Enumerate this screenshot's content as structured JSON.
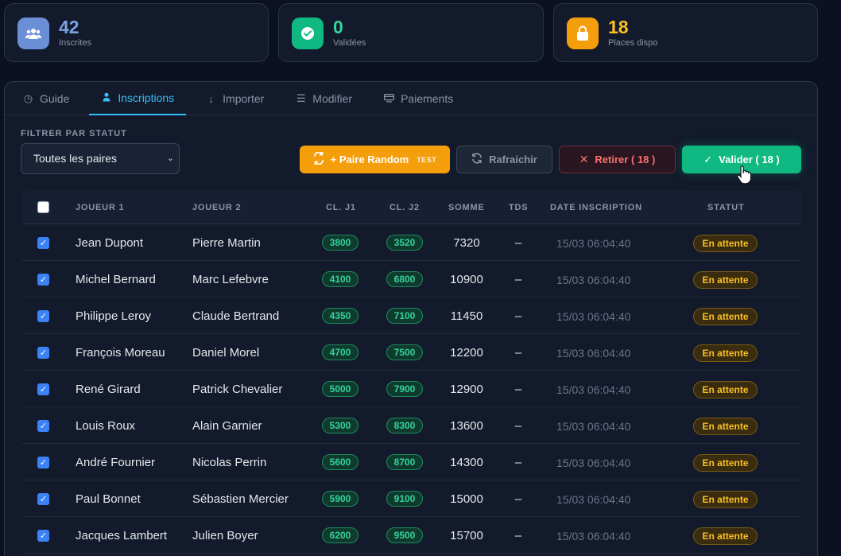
{
  "stats": [
    {
      "value": "42",
      "label": "Inscrites",
      "color": "#7aa2e3",
      "icon": "users-icon"
    },
    {
      "value": "0",
      "label": "Validées",
      "color": "#34d399",
      "icon": "check-circle-icon"
    },
    {
      "value": "18",
      "label": "Places dispo",
      "color": "#fbbf24",
      "icon": "lock-icon"
    }
  ],
  "tabs": [
    {
      "label": "Guide",
      "icon": "clock-icon"
    },
    {
      "label": "Inscriptions",
      "icon": "user-icon",
      "active": true
    },
    {
      "label": "Importer",
      "icon": "download-arrow-icon"
    },
    {
      "label": "Modifier",
      "icon": "list-icon"
    },
    {
      "label": "Paiements",
      "icon": "card-icon"
    }
  ],
  "filter": {
    "label": "FILTRER PAR STATUT",
    "selected": "Toutes les paires"
  },
  "buttons": {
    "random_label": "+ Paire Random",
    "random_badge": "TEST",
    "refresh_label": "Rafraichir",
    "retire_label": "Retirer ( 18 )",
    "valid_label": "Valider ( 18 )"
  },
  "table": {
    "headers": {
      "j1": "JOUEUR 1",
      "j2": "JOUEUR 2",
      "cl1": "CL. J1",
      "cl2": "CL. J2",
      "somme": "SOMME",
      "tds": "TDS",
      "date": "DATE INSCRIPTION",
      "statut": "STATUT"
    },
    "rows": [
      {
        "j1": "Jean Dupont",
        "j2": "Pierre Martin",
        "cl1": "3800",
        "cl2": "3520",
        "somme": "7320",
        "tds": "–",
        "date": "15/03 06:04:40",
        "statut": "En attente"
      },
      {
        "j1": "Michel Bernard",
        "j2": "Marc Lefebvre",
        "cl1": "4100",
        "cl2": "6800",
        "somme": "10900",
        "tds": "–",
        "date": "15/03 06:04:40",
        "statut": "En attente"
      },
      {
        "j1": "Philippe Leroy",
        "j2": "Claude Bertrand",
        "cl1": "4350",
        "cl2": "7100",
        "somme": "11450",
        "tds": "–",
        "date": "15/03 06:04:40",
        "statut": "En attente"
      },
      {
        "j1": "François Moreau",
        "j2": "Daniel Morel",
        "cl1": "4700",
        "cl2": "7500",
        "somme": "12200",
        "tds": "–",
        "date": "15/03 06:04:40",
        "statut": "En attente"
      },
      {
        "j1": "René Girard",
        "j2": "Patrick Chevalier",
        "cl1": "5000",
        "cl2": "7900",
        "somme": "12900",
        "tds": "–",
        "date": "15/03 06:04:40",
        "statut": "En attente"
      },
      {
        "j1": "Louis Roux",
        "j2": "Alain Garnier",
        "cl1": "5300",
        "cl2": "8300",
        "somme": "13600",
        "tds": "–",
        "date": "15/03 06:04:40",
        "statut": "En attente"
      },
      {
        "j1": "André Fournier",
        "j2": "Nicolas Perrin",
        "cl1": "5600",
        "cl2": "8700",
        "somme": "14300",
        "tds": "–",
        "date": "15/03 06:04:40",
        "statut": "En attente"
      },
      {
        "j1": "Paul Bonnet",
        "j2": "Sébastien Mercier",
        "cl1": "5900",
        "cl2": "9100",
        "somme": "15000",
        "tds": "–",
        "date": "15/03 06:04:40",
        "statut": "En attente"
      },
      {
        "j1": "Jacques Lambert",
        "j2": "Julien Boyer",
        "cl1": "6200",
        "cl2": "9500",
        "somme": "15700",
        "tds": "–",
        "date": "15/03 06:04:40",
        "statut": "En attente"
      }
    ]
  }
}
